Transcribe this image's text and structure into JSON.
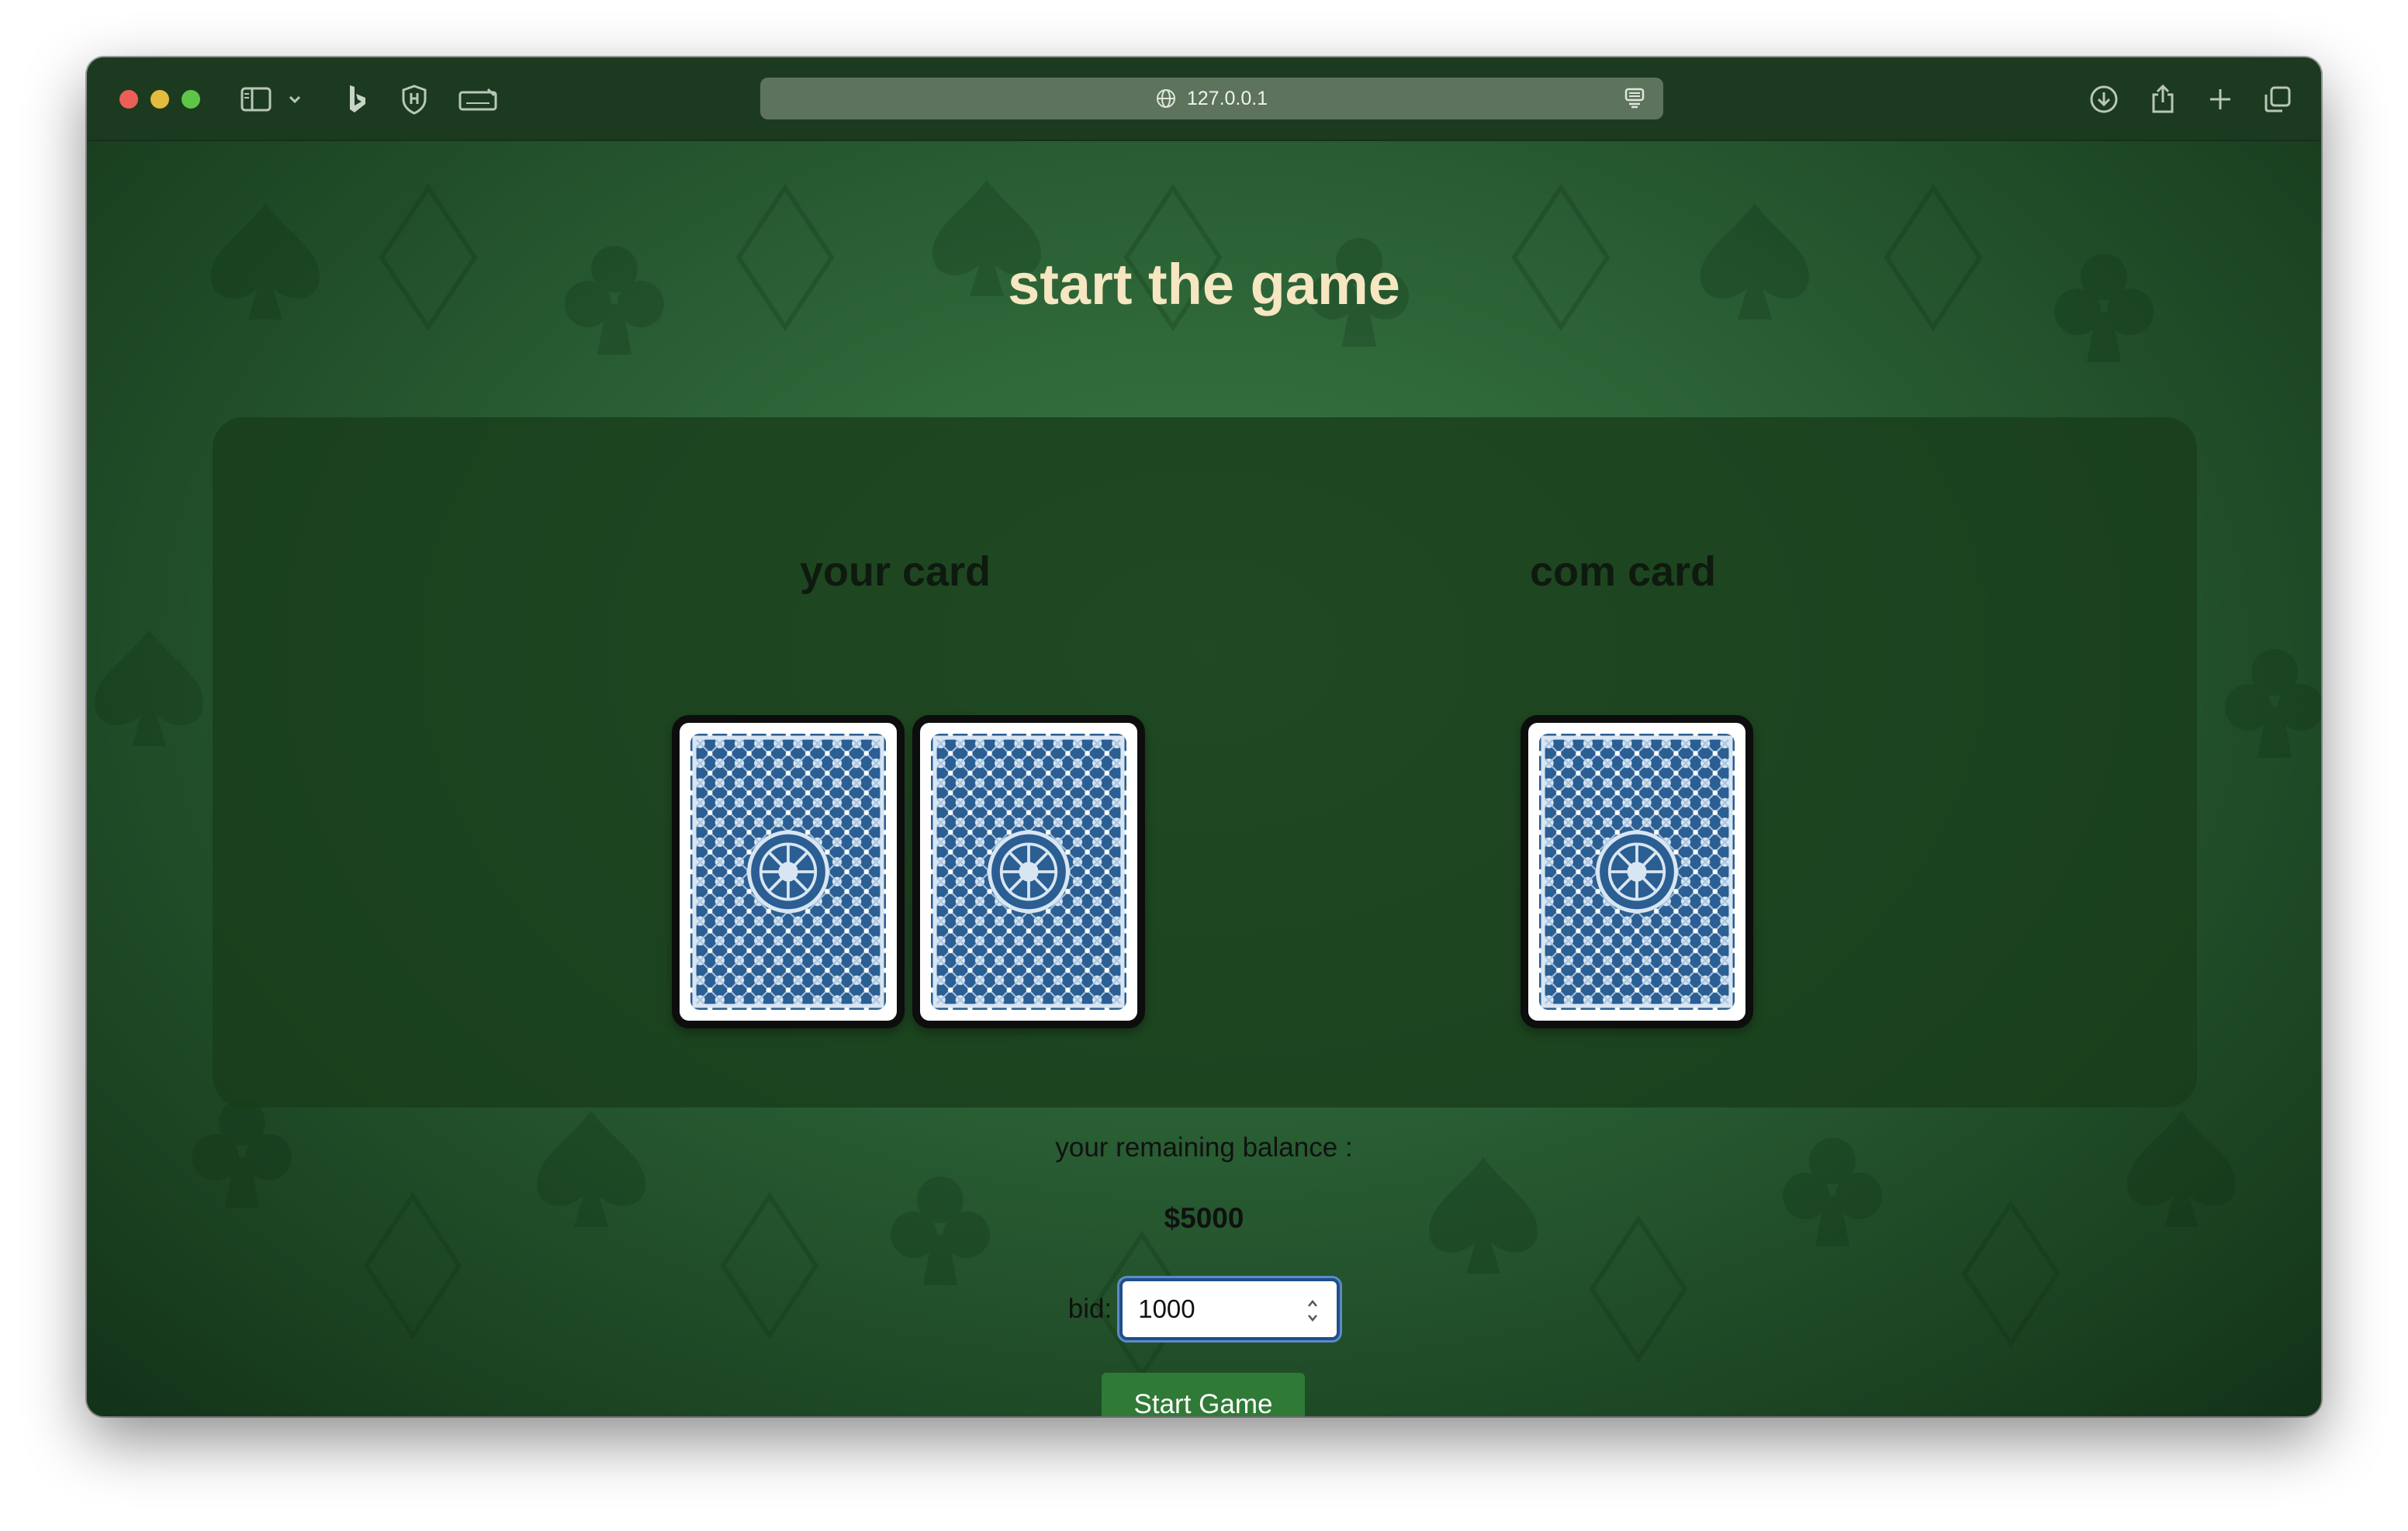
{
  "browser": {
    "url": "127.0.0.1"
  },
  "game": {
    "title": "start the game",
    "player_hand": {
      "label": "your card",
      "card_count": 2,
      "card_state": "face-down"
    },
    "computer_hand": {
      "label": "com card",
      "card_count": 1,
      "card_state": "face-down"
    },
    "balance_label": "your remaining balance :",
    "balance_value": "$5000",
    "bid_label": "bid:",
    "bid_value": "1000",
    "start_button_label": "Start Game"
  },
  "colors": {
    "title": "#f6e6c1",
    "felt": "#2b6135",
    "panel": "#183c19",
    "button": "#2f7a36",
    "card_back": "#2b5e92"
  },
  "icons": [
    "sidebar-icon",
    "chevron-down-icon",
    "bing-icon",
    "shield-icon",
    "keyboard-icon",
    "globe-icon",
    "reader-icon",
    "download-icon",
    "share-icon",
    "plus-icon",
    "tabs-icon"
  ]
}
